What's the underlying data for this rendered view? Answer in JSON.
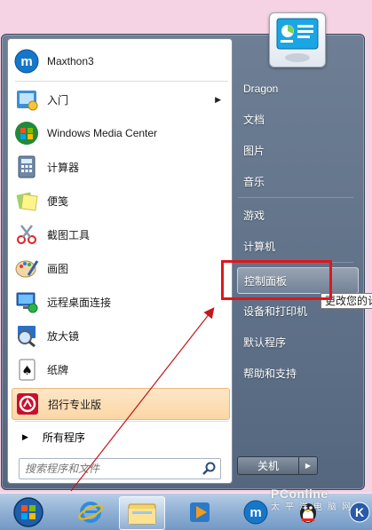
{
  "programs": [
    {
      "label": "Maxthon3",
      "icon": "maxthon-icon"
    },
    {
      "label": "入门",
      "icon": "getting-started-icon",
      "submenu": true
    },
    {
      "label": "Windows Media Center",
      "icon": "media-center-icon"
    },
    {
      "label": "计算器",
      "icon": "calculator-icon"
    },
    {
      "label": "便笺",
      "icon": "sticky-notes-icon"
    },
    {
      "label": "截图工具",
      "icon": "snipping-tool-icon"
    },
    {
      "label": "画图",
      "icon": "paint-icon"
    },
    {
      "label": "远程桌面连接",
      "icon": "remote-desktop-icon"
    },
    {
      "label": "放大镜",
      "icon": "magnifier-icon"
    },
    {
      "label": "纸牌",
      "icon": "solitaire-icon"
    },
    {
      "label": "招行专业版",
      "icon": "cmb-icon"
    }
  ],
  "all_programs_label": "所有程序",
  "search": {
    "placeholder": "搜索程序和文件"
  },
  "right_items": [
    "Dragon",
    "文档",
    "图片",
    "音乐",
    "游戏",
    "计算机",
    "控制面板",
    "设备和打印机",
    "默认程序",
    "帮助和支持"
  ],
  "shutdown_label": "关机",
  "tooltip": "更改您的计",
  "watermark": {
    "brand": "PConline",
    "sub": "太平洋电脑网"
  },
  "colors": {
    "highlight_border": "#e0161b",
    "menu_right": "#55677f",
    "taskbar": "#8fb0d4"
  }
}
